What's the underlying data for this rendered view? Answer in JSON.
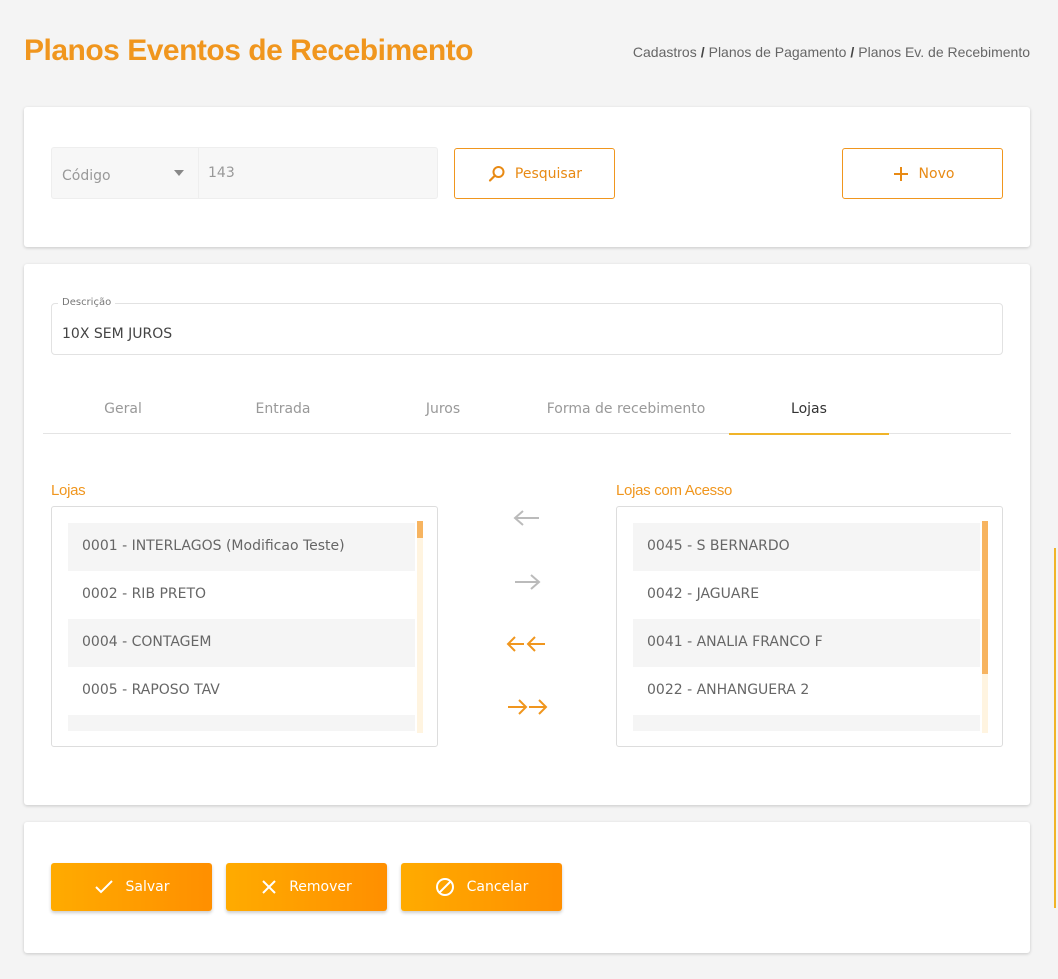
{
  "header": {
    "title": "Planos Eventos de Recebimento",
    "breadcrumb": [
      "Cadastros",
      "Planos de Pagamento",
      "Planos Ev. de Recebimento"
    ],
    "separator": "/"
  },
  "search": {
    "field_selected": "Código",
    "value": "143",
    "search_label": "Pesquisar",
    "new_label": "Novo"
  },
  "form": {
    "description_label": "Descrição",
    "description_value": "10X SEM JUROS"
  },
  "tabs": [
    {
      "label": "Geral",
      "active": false
    },
    {
      "label": "Entrada",
      "active": false
    },
    {
      "label": "Juros",
      "active": false
    },
    {
      "label": "Forma de recebimento",
      "active": false
    },
    {
      "label": "Lojas",
      "active": true
    }
  ],
  "stores": {
    "available_title": "Lojas",
    "available": [
      "0001 - INTERLAGOS (Modificao Teste)",
      "0002 - RIB PRETO",
      "0004 - CONTAGEM",
      "0005 - RAPOSO TAV",
      ""
    ],
    "access_title": "Lojas com Acesso",
    "access": [
      "0045 - S BERNARDO",
      "0042 - JAGUARE",
      "0041 - ANALIA FRANCO F",
      "0022 - ANHANGUERA 2",
      ""
    ],
    "available_scroll_fraction": 0.08,
    "access_scroll_fraction": 0.72
  },
  "transfer_buttons": [
    {
      "icon": "arrow-left-icon",
      "enabled": false
    },
    {
      "icon": "arrow-right-icon",
      "enabled": false
    },
    {
      "icon": "double-arrow-left-icon",
      "enabled": true
    },
    {
      "icon": "double-arrow-right-icon",
      "enabled": true
    }
  ],
  "actions": {
    "save_label": "Salvar",
    "remove_label": "Remover",
    "cancel_label": "Cancelar"
  },
  "colors": {
    "accent": "#f0961e",
    "button_gradient_start": "#ffab00",
    "button_gradient_end": "#ff8f00",
    "disabled_arrow": "#bbbbbb"
  }
}
